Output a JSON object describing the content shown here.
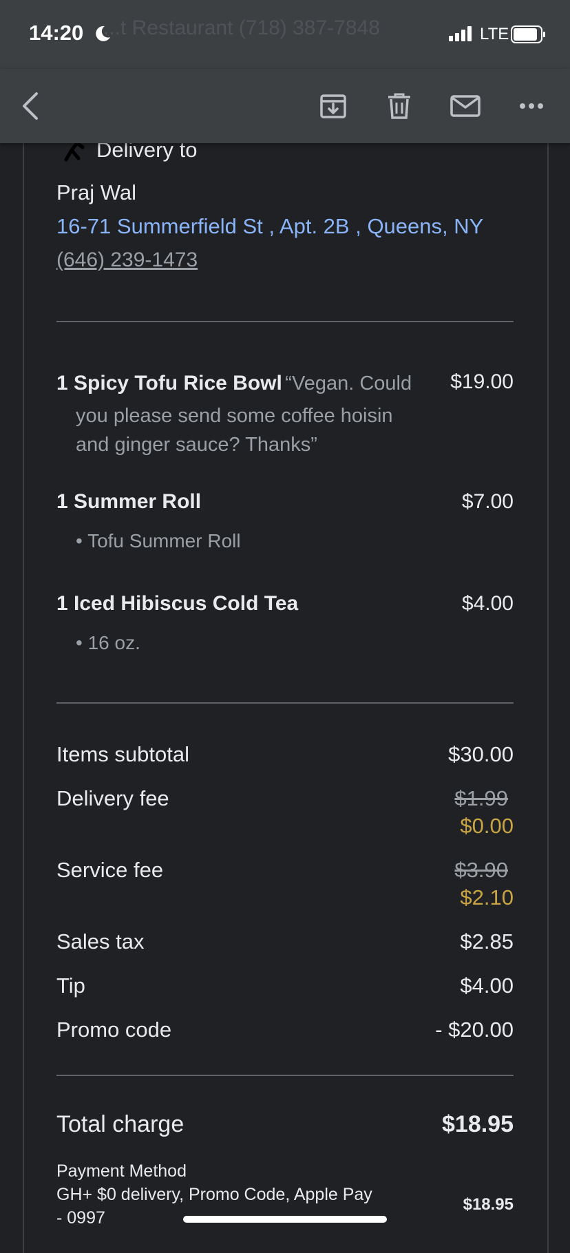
{
  "status_bar": {
    "time": "14:20",
    "background_text": "...t Restaurant (718) 387-7848",
    "network": "LTE",
    "icons": [
      "moon-icon",
      "signal-icon",
      "battery-icon"
    ]
  },
  "toolbar": {
    "icons": [
      "back-arrow-icon",
      "archive-icon",
      "trash-icon",
      "mail-icon",
      "more-icon"
    ]
  },
  "delivery": {
    "label": "Delivery to",
    "name": "Praj Wal",
    "address": "16-71 Summerfield St , Apt. 2B , Queens, NY",
    "phone": "(646) 239-1473"
  },
  "items": [
    {
      "title": "1 Spicy Tofu Rice Bowl",
      "note_line1": "“Vegan. Could",
      "note_line2": "you please send some coffee hoisin",
      "note_line3": "and ginger sauce? Thanks”",
      "price": "$19.00"
    },
    {
      "title": "1 Summer Roll",
      "sub": "• Tofu Summer Roll",
      "price": "$7.00"
    },
    {
      "title": "1 Iced Hibiscus Cold Tea",
      "sub": "• 16 oz.",
      "price": "$4.00"
    }
  ],
  "fees": {
    "subtotal_label": "Items subtotal",
    "subtotal": "$30.00",
    "delivery_label": "Delivery fee",
    "delivery_original": "$1.99",
    "delivery_discounted": "$0.00",
    "service_label": "Service fee",
    "service_original": "$3.90",
    "service_discounted": "$2.10",
    "tax_label": "Sales tax",
    "tax": "$2.85",
    "tip_label": "Tip",
    "tip": "$4.00",
    "promo_label": "Promo code",
    "promo": "- $20.00"
  },
  "total": {
    "label": "Total charge",
    "amount": "$18.95"
  },
  "payment": {
    "label": "Payment Method",
    "line1": "GH+ $0 delivery, Promo Code, Apple Pay",
    "line2": "- 0997",
    "amount": "$18.95"
  },
  "colors": {
    "background": "#202124",
    "toolbar": "#3c4043",
    "link": "#8ab4f8",
    "discount": "#c9a544"
  }
}
